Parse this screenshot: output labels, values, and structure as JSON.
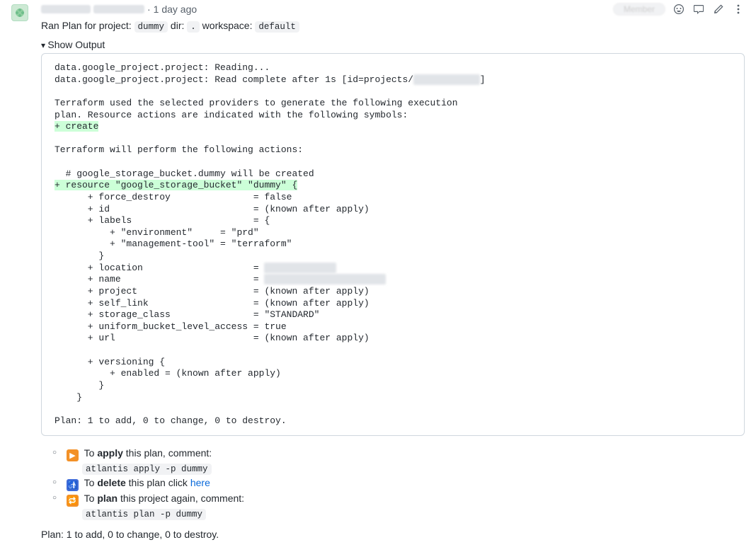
{
  "header": {
    "timestamp_sep": " · ",
    "timestamp": "1 day ago",
    "member_label": "Member"
  },
  "ran_line": {
    "prefix": "Ran Plan for project: ",
    "project": "dummy",
    "dir_label": " dir: ",
    "dir": ".",
    "ws_label": " workspace: ",
    "ws": "default"
  },
  "toggle": {
    "label": "Show Output"
  },
  "output": {
    "l01": "data.google_project.project: Reading...",
    "l02a": "data.google_project.project: Read complete after 1s [id=projects/",
    "l02_redact": "xxxxxxxxxxxx",
    "l02b": "]",
    "l04": "Terraform used the selected providers to generate the following execution",
    "l05": "plan. Resource actions are indicated with the following symbols:",
    "l06": "+ create",
    "l08": "Terraform will perform the following actions:",
    "l10": "  # google_storage_bucket.dummy will be created",
    "l11": "+ resource \"google_storage_bucket\" \"dummy\" {",
    "l12": "      + force_destroy               = false",
    "l13": "      + id                          = (known after apply)",
    "l14": "      + labels                      = {",
    "l15": "          + \"environment\"     = \"prd\"",
    "l16": "          + \"management-tool\" = \"terraform\"",
    "l17": "        }",
    "l18a": "      + location                    = ",
    "l18_redact": "XXXXX  XXXX  ",
    "l19a": "      + name                        = ",
    "l19_redact": " XXXX  XXX  XXXX  XXX ",
    "l20": "      + project                     = (known after apply)",
    "l21": "      + self_link                   = (known after apply)",
    "l22": "      + storage_class               = \"STANDARD\"",
    "l23": "      + uniform_bucket_level_access = true",
    "l24": "      + url                         = (known after apply)",
    "l26": "      + versioning {",
    "l27": "          + enabled = (known after apply)",
    "l28": "        }",
    "l29": "    }",
    "l31": "Plan: 1 to add, 0 to change, 0 to destroy."
  },
  "hints": {
    "apply_pre": " To ",
    "apply_bold": "apply",
    "apply_post": " this plan, comment:",
    "apply_cmd": "atlantis apply -p dummy",
    "delete_pre": " To ",
    "delete_bold": "delete",
    "delete_post": " this plan click ",
    "delete_link": "here",
    "plan_pre": " To ",
    "plan_bold": "plan",
    "plan_post": " this project again, comment:",
    "plan_cmd": "atlantis plan -p dummy",
    "arrow_glyph": "▶",
    "trash_glyph": "🚮",
    "repeat_glyph": "🔁"
  },
  "summary": "Plan: 1 to add, 0 to change, 0 to destroy."
}
